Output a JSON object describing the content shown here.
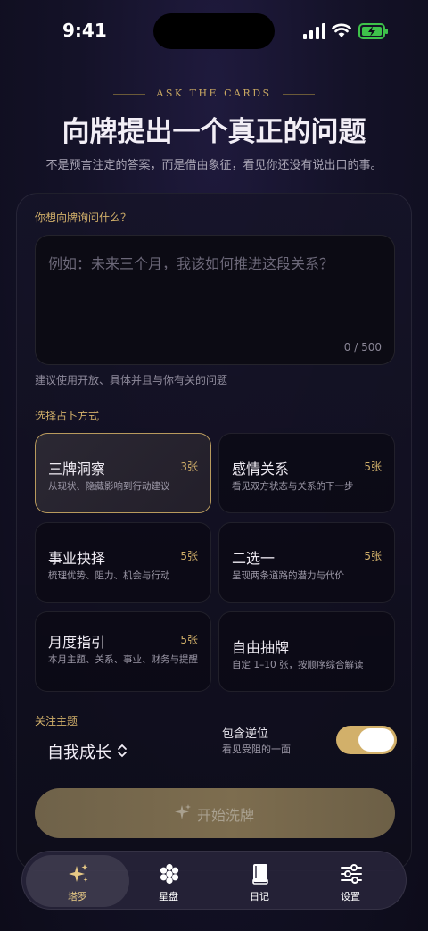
{
  "status_bar": {
    "time": "9:41"
  },
  "header": {
    "eyebrow": "ASK THE CARDS",
    "title": "向牌提出一个真正的问题",
    "subtitle": "不是预言注定的答案，而是借由象征，看见你还没有说出口的事。"
  },
  "question": {
    "label": "你想向牌询问什么？",
    "placeholder": "例如：未来三个月，我该如何推进这段关系？",
    "value": "",
    "counter": "0 / 500",
    "hint": "建议使用开放、具体并且与你有关的问题"
  },
  "method": {
    "label": "选择占卜方式",
    "spreads": [
      {
        "name": "三牌洞察",
        "count": "3张",
        "desc": "从现状、隐藏影响到行动建议",
        "selected": true
      },
      {
        "name": "感情关系",
        "count": "5张",
        "desc": "看见双方状态与关系的下一步",
        "selected": false
      },
      {
        "name": "事业抉择",
        "count": "5张",
        "desc": "梳理优势、阻力、机会与行动",
        "selected": false
      },
      {
        "name": "二选一",
        "count": "5张",
        "desc": "呈现两条道路的潜力与代价",
        "selected": false
      },
      {
        "name": "月度指引",
        "count": "5张",
        "desc": "本月主题、关系、事业、财务与提醒",
        "selected": false
      },
      {
        "name": "自由抽牌",
        "count": "",
        "desc": "自定 1–10 张，按顺序综合解读",
        "selected": false
      }
    ]
  },
  "focus": {
    "label": "关注主题",
    "value": "自我成长"
  },
  "reversed": {
    "title": "包含逆位",
    "subtitle": "看见受阻的一面",
    "enabled": true
  },
  "start_button": {
    "label": "开始洗牌"
  },
  "tabbar": {
    "tabs": [
      {
        "label": "塔罗",
        "icon": "sparkles-icon",
        "active": true
      },
      {
        "label": "星盘",
        "icon": "flower-icon",
        "active": false
      },
      {
        "label": "日记",
        "icon": "book-icon",
        "active": false
      },
      {
        "label": "设置",
        "icon": "sliders-icon",
        "active": false
      }
    ]
  },
  "colors": {
    "accent": "#d2b06a",
    "background": "#141228",
    "toggle_on": "#d2b06a"
  }
}
